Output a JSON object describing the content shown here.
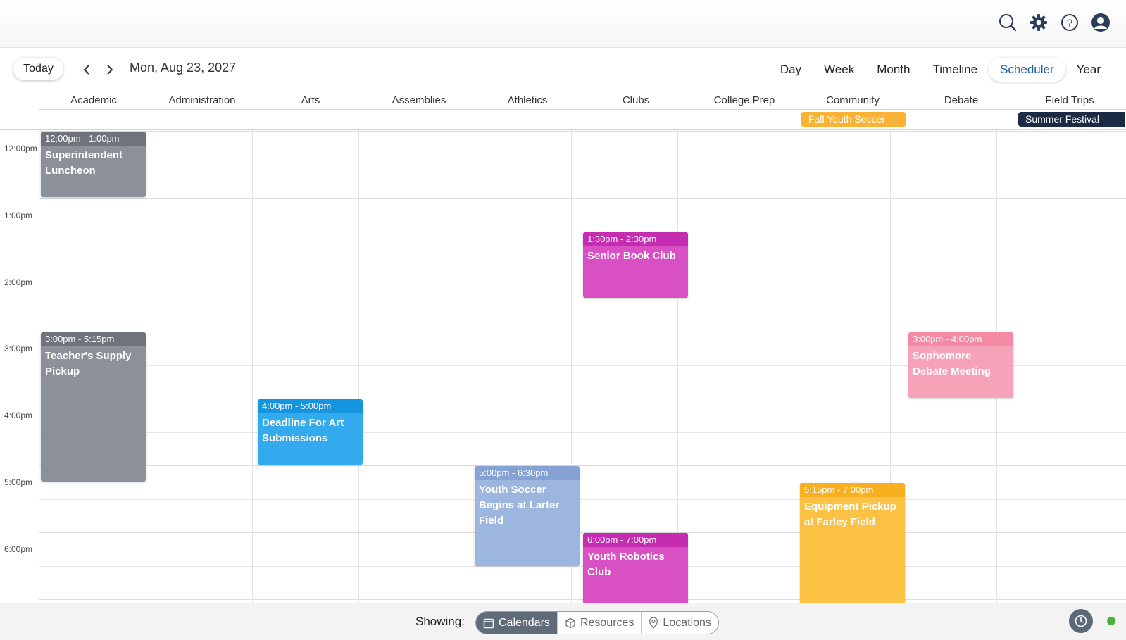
{
  "toolbar": {
    "today_label": "Today",
    "date_label": "Mon, Aug 23, 2027",
    "views": [
      "Day",
      "Week",
      "Month",
      "Timeline",
      "Scheduler",
      "Year"
    ],
    "active_view": "Scheduler"
  },
  "resources": [
    "Academic",
    "Administration",
    "Arts",
    "Assemblies",
    "Athletics",
    "Clubs",
    "College Prep",
    "Community",
    "Debate",
    "Field Trips"
  ],
  "all_day_events": [
    {
      "title": "Fall Youth Soccer",
      "resource": "Community",
      "color": "#f9b233"
    },
    {
      "title": "Summer Festival",
      "resource": "Field Trips",
      "color": "#1b2a45"
    }
  ],
  "time_labels": [
    "12:00pm",
    "1:00pm",
    "2:00pm",
    "3:00pm",
    "4:00pm",
    "5:00pm",
    "6:00pm"
  ],
  "events": [
    {
      "time": "12:00pm - 1:00pm",
      "title": "Superintendent Luncheon",
      "resource": "Academic",
      "color": "#8c9099",
      "head_color": "#6e737c"
    },
    {
      "time": "3:00pm - 5:15pm",
      "title": "Teacher's Supply Pickup",
      "resource": "Academic",
      "color": "#8c9099",
      "head_color": "#6e737c"
    },
    {
      "time": "4:00pm - 5:00pm",
      "title": "Deadline For Art Submissions",
      "resource": "Arts",
      "color": "#33aaee",
      "head_color": "#1594e0"
    },
    {
      "time": "5:00pm - 6:30pm",
      "title": "Youth Soccer Begins at Larter Field",
      "resource": "Athletics",
      "color": "#9cb6e0",
      "head_color": "#86a2d4"
    },
    {
      "time": "1:30pm - 2:30pm",
      "title": "Senior Book Club",
      "resource": "Clubs",
      "color": "#d94fc4",
      "head_color": "#c52db0"
    },
    {
      "time": "6:00pm - 7:00pm",
      "title": "Youth Robotics Club",
      "resource": "Clubs",
      "color": "#d94fc4",
      "head_color": "#c52db0"
    },
    {
      "time": "5:15pm - 7:00pm",
      "title": "Equipment Pickup at Farley Field",
      "resource": "Community",
      "color": "#fbc143",
      "head_color": "#f8b020"
    },
    {
      "time": "3:00pm - 4:00pm",
      "title": "Sophomore Debate Meeting",
      "resource": "Debate",
      "color": "#f6a2b8",
      "head_color": "#f28aa4"
    }
  ],
  "footer": {
    "showing_label": "Showing:",
    "segments": [
      "Calendars",
      "Resources",
      "Locations"
    ],
    "active_segment": "Calendars"
  },
  "icons": [
    "search-icon",
    "gear-icon",
    "help-icon",
    "user-icon",
    "calendar-icon",
    "cube-icon",
    "location-pin-icon",
    "clock-icon"
  ]
}
